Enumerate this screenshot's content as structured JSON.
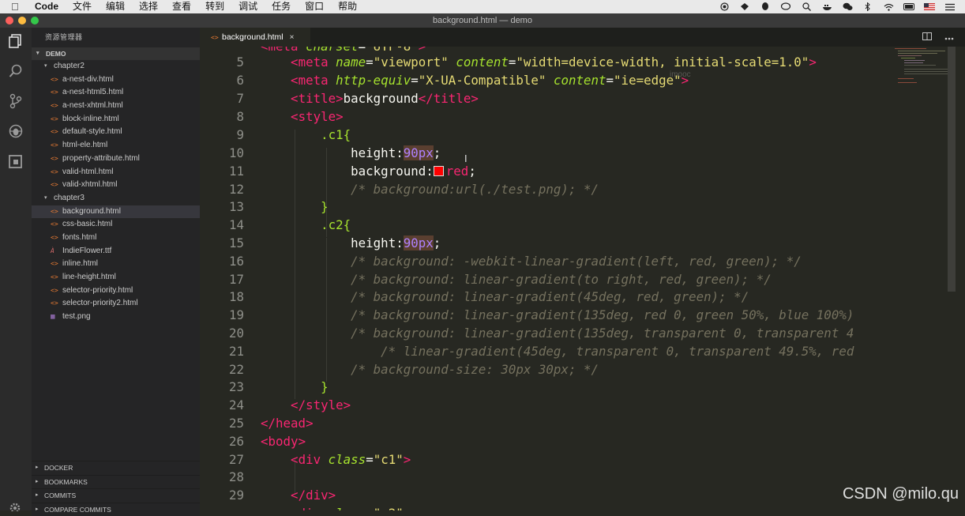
{
  "menubar": {
    "app": "Code",
    "items": [
      "文件",
      "编辑",
      "选择",
      "查看",
      "转到",
      "调试",
      "任务",
      "窗口",
      "帮助"
    ]
  },
  "window": {
    "title": "background.html — demo"
  },
  "sidebar": {
    "title": "资源管理器",
    "root": "DEMO",
    "folders": [
      {
        "name": "chapter2",
        "files": [
          "a-nest-div.html",
          "a-nest-html5.html",
          "a-nest-xhtml.html",
          "block-inline.html",
          "default-style.html",
          "html-ele.html",
          "property-attribute.html",
          "valid-html.html",
          "valid-xhtml.html"
        ]
      },
      {
        "name": "chapter3",
        "files": [
          "background.html",
          "css-basic.html",
          "fonts.html",
          "IndieFlower.ttf",
          "inline.html",
          "line-height.html",
          "selector-priority.html",
          "selector-priority2.html",
          "test.png"
        ]
      }
    ],
    "selected_file": "background.html",
    "bottom_sections": [
      "DOCKER",
      "BOOKMARKS",
      "COMMITS",
      "COMPARE COMMITS"
    ]
  },
  "editor": {
    "tab_label": "background.html",
    "tab_close": "×",
    "line_numbers": [
      "5",
      "6",
      "7",
      "8",
      "9",
      "10",
      "11",
      "12",
      "13",
      "14",
      "15",
      "16",
      "17",
      "18",
      "19",
      "20",
      "21",
      "22",
      "23",
      "24",
      "25",
      "26",
      "27",
      "28",
      "29"
    ],
    "code": {
      "l5_tag": "meta",
      "l5_attr1": "name",
      "l5_val1": "\"viewport\"",
      "l5_attr2": "content",
      "l5_val2": "\"width=device-width, initial-scale=1.0\"",
      "l6_tag": "meta",
      "l6_attr1": "http-equiv",
      "l6_val1": "\"X-UA-Compatible\"",
      "l6_attr2": "content",
      "l6_val2": "\"ie=edge\"",
      "l7_open": "title",
      "l7_text": "background",
      "l7_close": "/title",
      "l8_tag": "style",
      "l9_sel": ".c1{",
      "l10_prop": "height:",
      "l10_val": "90px",
      "l10_end": ";",
      "l11_prop": "background:",
      "l11_val": "red",
      "l11_end": ";",
      "l12_comment": "/* background:url(./test.png); */",
      "l13": "}",
      "l14_sel": ".c2{",
      "l15_prop": "height:",
      "l15_val": "90px",
      "l15_end": ";",
      "l16_comment": "/* background: -webkit-linear-gradient(left, red, green); */",
      "l17_comment": "/* background: linear-gradient(to right, red, green); */",
      "l18_comment": "/* background: linear-gradient(45deg, red, green); */",
      "l19_comment": "/* background: linear-gradient(135deg, red 0, green 50%, blue 100%)",
      "l20_comment": "/* background: linear-gradient(135deg, transparent 0, transparent 4",
      "l21_comment": "/* linear-gradient(45deg, transparent 0, transparent 49.5%, red",
      "l22_comment": "/* background-size: 30px 30px; */",
      "l23": "}",
      "l24_tag": "/style",
      "l25_tag": "/head",
      "l26_tag": "body",
      "l27_tag": "div",
      "l27_attr": "class",
      "l27_val": "\"c1\"",
      "l29_tag": "/div"
    }
  },
  "overlay": {
    "faint_watermark": "imooc",
    "watermark": "CSDN @milo.qu"
  },
  "colors": {
    "editor_bg": "#272822",
    "sidebar_bg": "#252526",
    "tag": "#f92672",
    "attr": "#a6e22e",
    "string": "#e6db74",
    "number": "#ae81ff",
    "comment": "#75715e"
  }
}
